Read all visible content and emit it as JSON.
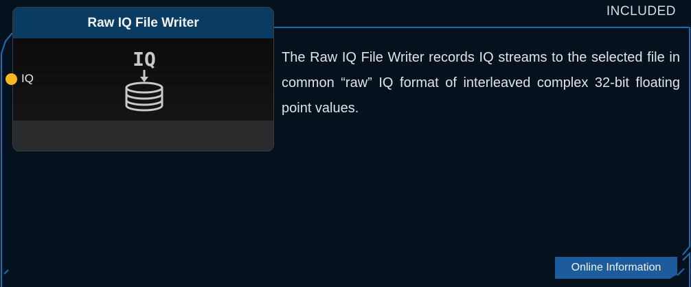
{
  "badge": {
    "label": "INCLUDED"
  },
  "node": {
    "title": "Raw IQ File Writer",
    "icon": "iq-database-write-icon",
    "icon_text": "IQ",
    "input_port": {
      "label": "IQ",
      "color": "#f6b81c"
    }
  },
  "description": {
    "text": "The Raw IQ File Writer records IQ streams to the select­ed file in common “raw” IQ format of interleaved com­plex 32-bit floating point values."
  },
  "actions": {
    "online_info_label": "Online Information"
  },
  "colors": {
    "background": "#05111c",
    "frame": "#1670b8",
    "header": "#0a3b62",
    "button": "#1d5c9c"
  }
}
